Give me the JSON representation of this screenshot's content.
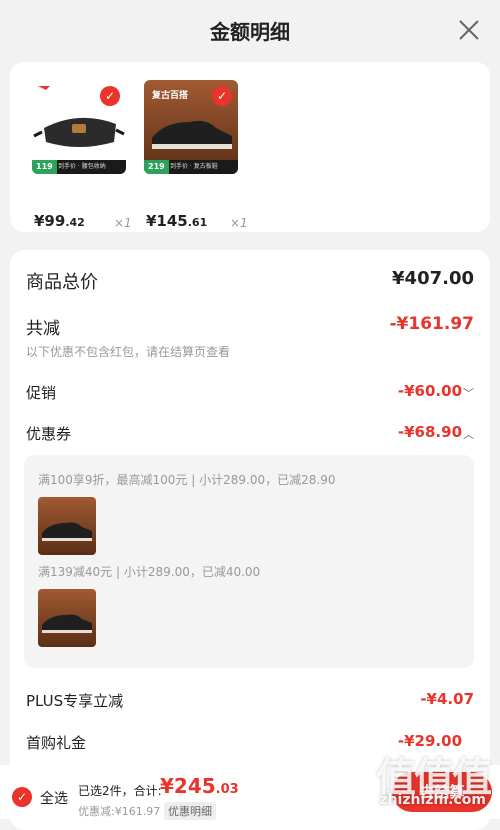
{
  "header": {
    "title": "金额明细"
  },
  "products": [
    {
      "price_main": "¥99",
      "price_cents": ".42",
      "qty": "×1",
      "badge_num": "119",
      "badge_text": "到手价 · 腰包收纳",
      "selected": true
    },
    {
      "price_main": "¥145",
      "price_cents": ".61",
      "qty": "×1",
      "badge_num": "219",
      "badge_text": "到手价 · 复古板鞋",
      "thumb_text": "复古百搭",
      "selected": true
    }
  ],
  "summary": {
    "total_label": "商品总价",
    "total_value": "¥407.00",
    "discount_label": "共减",
    "discount_value": "-¥161.97",
    "note": "以下优惠不包含红包，请在结算页查看",
    "promo_label": "促销",
    "promo_value": "-¥60.00",
    "coupon_label": "优惠券",
    "coupon_value": "-¥68.90",
    "coupons": [
      {
        "text": "满100享9折，最高减100元 | 小计289.00，已减28.90"
      },
      {
        "text": "满139减40元 | 小计289.00，已减40.00"
      }
    ],
    "plus_label": "PLUS专享立减",
    "plus_value": "-¥4.07",
    "firstbuy_label": "首购礼金",
    "firstbuy_value": "-¥29.00"
  },
  "footer": {
    "select_all": "全选",
    "selected_count": "已选2件，合计:",
    "sum_main": "¥245",
    "sum_cents": ".03",
    "saved": "优惠减:¥161.97",
    "detail_link": "优惠明细",
    "checkout": "去结算"
  },
  "watermark": {
    "text": "值值值",
    "url": "zhizhizhi.com"
  }
}
